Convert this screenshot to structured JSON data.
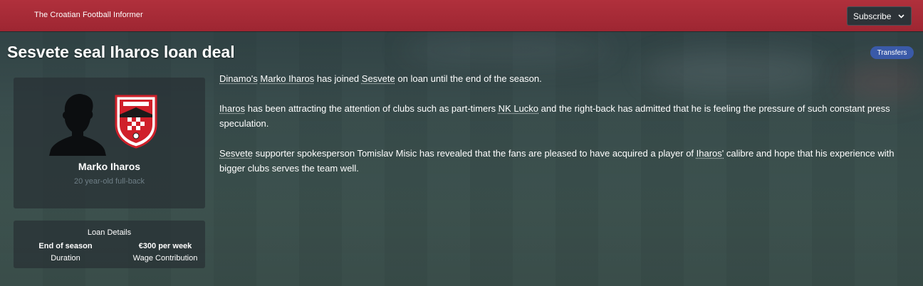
{
  "header": {
    "brand": "The Croatian Football Informer",
    "subscribe_label": "Subscribe",
    "bar_color": "#a82b37"
  },
  "article": {
    "headline": "Sesvete seal Iharos loan deal",
    "tag": "Transfers",
    "tag_color": "#3a5aa8",
    "paragraphs": [
      [
        {
          "text": "Dinamo's",
          "link": true
        },
        {
          "text": " ",
          "link": false
        },
        {
          "text": "Marko Iharos",
          "link": true
        },
        {
          "text": " has joined ",
          "link": false
        },
        {
          "text": "Sesvete",
          "link": true
        },
        {
          "text": " on loan until the end of the season.",
          "link": false
        }
      ],
      [
        {
          "text": "Iharos",
          "link": true
        },
        {
          "text": " has been attracting the attention of clubs such as part-timers ",
          "link": false
        },
        {
          "text": "NK Lucko",
          "link": true
        },
        {
          "text": " and the right-back has admitted that he is feeling the pressure of such constant press speculation.",
          "link": false
        }
      ],
      [
        {
          "text": "Sesvete",
          "link": true
        },
        {
          "text": " supporter spokesperson Tomislav Misic has revealed that the fans are pleased to have acquired a player of ",
          "link": false
        },
        {
          "text": "Iharos'",
          "link": true
        },
        {
          "text": " calibre and hope that his experience with bigger clubs serves the team well.",
          "link": false
        }
      ]
    ]
  },
  "player": {
    "name": "Marko Iharos",
    "description": "20 year-old full-back",
    "avatar_icon": "player-silhouette-icon",
    "club_crest_icon": "club-crest-icon"
  },
  "loan": {
    "title": "Loan Details",
    "items": [
      {
        "value": "End of season",
        "label": "Duration"
      },
      {
        "value": "€300 per week",
        "label": "Wage Contribution"
      }
    ]
  }
}
